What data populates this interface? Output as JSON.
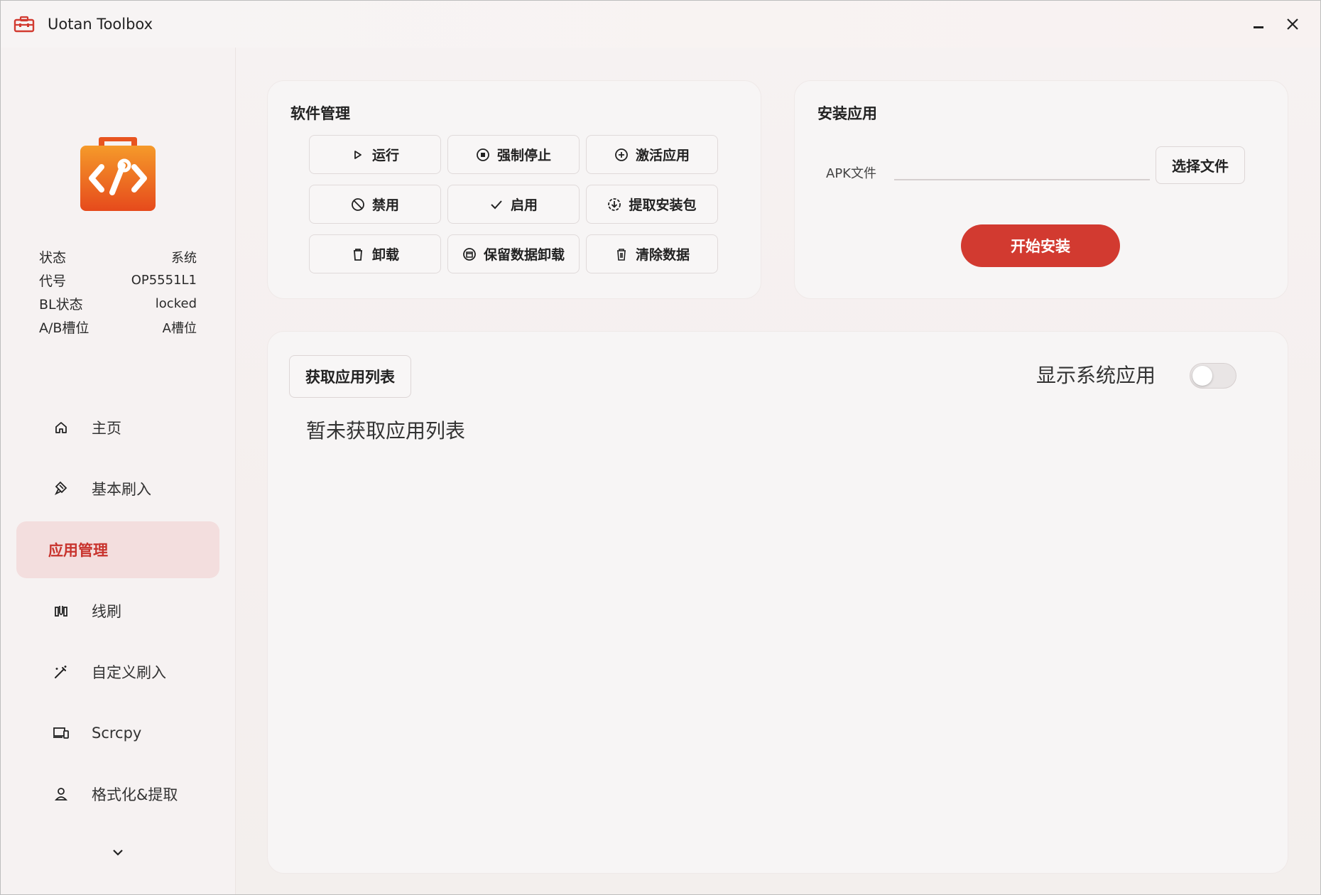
{
  "window": {
    "title": "Uotan Toolbox"
  },
  "colors": {
    "accent": "#d23a30",
    "accent_soft": "#f3dede",
    "logo_orange": "#e8541f"
  },
  "device_info": [
    {
      "label": "状态",
      "value": "系统"
    },
    {
      "label": "代号",
      "value": "OP5551L1"
    },
    {
      "label": "BL状态",
      "value": "locked"
    },
    {
      "label": "A/B槽位",
      "value": "A槽位"
    }
  ],
  "nav": {
    "items": [
      {
        "label": "主页",
        "icon": "home-icon"
      },
      {
        "label": "基本刷入",
        "icon": "flash-icon"
      },
      {
        "label": "应用管理",
        "icon": "",
        "active": true
      },
      {
        "label": "线刷",
        "icon": "usb-flash-icon"
      },
      {
        "label": "自定义刷入",
        "icon": "wand-icon"
      },
      {
        "label": "Scrcpy",
        "icon": "devices-icon"
      },
      {
        "label": "格式化&提取",
        "icon": "extract-icon"
      }
    ]
  },
  "software": {
    "title": "软件管理",
    "buttons": [
      {
        "label": "运行",
        "icon": "play-icon"
      },
      {
        "label": "强制停止",
        "icon": "stop-circle-icon"
      },
      {
        "label": "激活应用",
        "icon": "add-circle-icon"
      },
      {
        "label": "禁用",
        "icon": "block-icon"
      },
      {
        "label": "启用",
        "icon": "check-icon"
      },
      {
        "label": "提取安装包",
        "icon": "download-circle-icon"
      },
      {
        "label": "卸载",
        "icon": "trash-icon"
      },
      {
        "label": "保留数据卸载",
        "icon": "archive-circle-icon"
      },
      {
        "label": "清除数据",
        "icon": "trash-icon"
      }
    ]
  },
  "install": {
    "title": "安装应用",
    "apk_label": "APK文件",
    "apk_value": "",
    "choose_label": "选择文件",
    "start_label": "开始安装"
  },
  "app_list": {
    "fetch_label": "获取应用列表",
    "show_system_label": "显示系统应用",
    "show_system_on": false,
    "empty_text": "暂未获取应用列表"
  }
}
